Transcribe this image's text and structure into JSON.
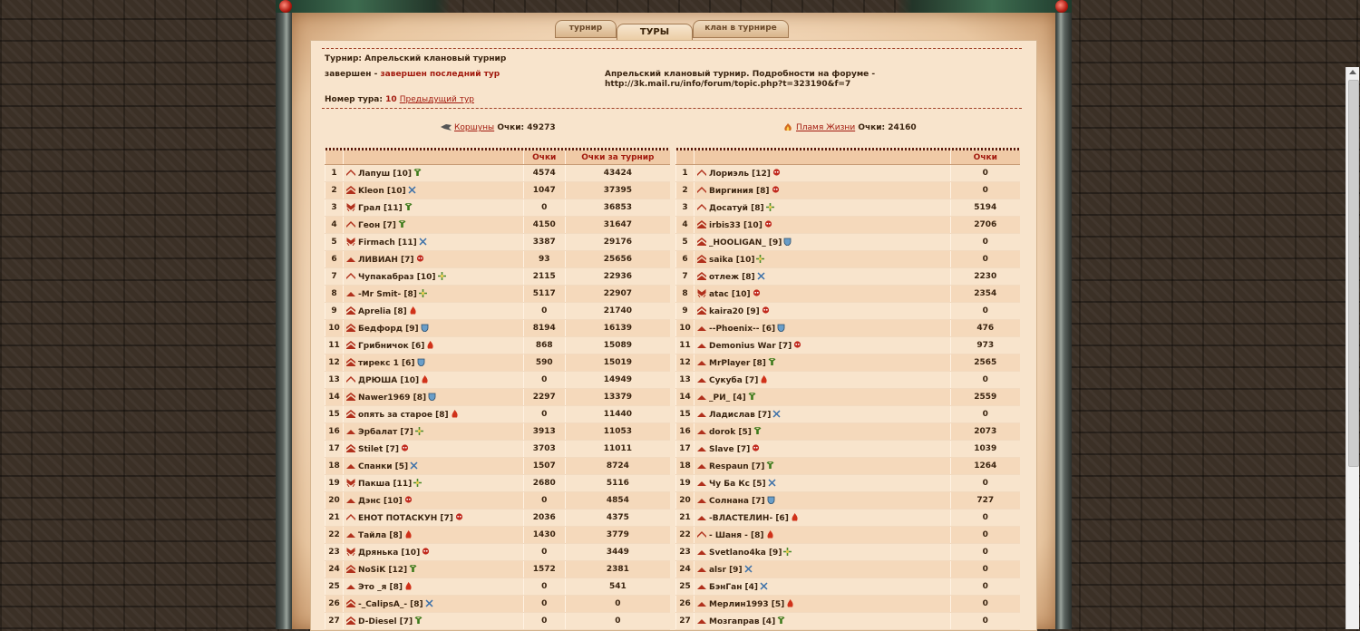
{
  "tabs": {
    "tournament": "турнир",
    "rounds": "ТУРЫ",
    "clan": "клан в турнире"
  },
  "info": {
    "tournament_label": "Турнир:",
    "tournament_name": "Апрельский клановый турнир",
    "status": "завершен",
    "status_sep": " - ",
    "status_detail": "завершен последний тур",
    "description": "Апрельский клановый турнир. Подробности на форуме -",
    "forum_link": "http://3k.mail.ru/info/forum/topic.php?t=323190&f=7",
    "round_label": "Номер тура:",
    "round_number": "10",
    "prev_round": "Предыдущий тур"
  },
  "clans": {
    "left": {
      "name": "Коршуны",
      "score_label": "Очки:",
      "score": "49273",
      "icon": "raven-flag-icon"
    },
    "right": {
      "name": "Пламя Жизни",
      "score_label": "Очки:",
      "score": "24160",
      "icon": "flame-icon"
    }
  },
  "table_left": {
    "headers": [
      "",
      "",
      "Очки",
      "Очки за турнир"
    ],
    "rows": [
      {
        "n": "1",
        "name": "Лапуш [10]",
        "badge": "elf",
        "score": "4574",
        "total": "43424",
        "rank": "r2"
      },
      {
        "n": "2",
        "name": "Kleon [10]",
        "badge": "swords",
        "score": "1047",
        "total": "37395",
        "rank": "r3"
      },
      {
        "n": "3",
        "name": "Грал [11]",
        "badge": "elf",
        "score": "0",
        "total": "36853",
        "rank": "r4"
      },
      {
        "n": "4",
        "name": "Геон [7]",
        "badge": "elf",
        "score": "4150",
        "total": "31647",
        "rank": "r2"
      },
      {
        "n": "5",
        "name": "Firmach [11]",
        "badge": "swords",
        "score": "3387",
        "total": "29176",
        "rank": "r4"
      },
      {
        "n": "6",
        "name": "ЛИВИАН [7]",
        "badge": "skull",
        "score": "93",
        "total": "25656",
        "rank": "r1"
      },
      {
        "n": "7",
        "name": "Чупакабраз [10]",
        "badge": "cross",
        "score": "2115",
        "total": "22936",
        "rank": "r2"
      },
      {
        "n": "8",
        "name": "-Mr Smit- [8]",
        "badge": "cross",
        "score": "5117",
        "total": "22907",
        "rank": "r1"
      },
      {
        "n": "9",
        "name": "Aprelia [8]",
        "badge": "fire",
        "score": "0",
        "total": "21740",
        "rank": "r3"
      },
      {
        "n": "10",
        "name": "Бедфорд [9]",
        "badge": "shield",
        "score": "8194",
        "total": "16139",
        "rank": "r3"
      },
      {
        "n": "11",
        "name": "Грибничок [6]",
        "badge": "fire",
        "score": "868",
        "total": "15089",
        "rank": "r3"
      },
      {
        "n": "12",
        "name": "тирекс 1 [6]",
        "badge": "shield",
        "score": "590",
        "total": "15019",
        "rank": "r3"
      },
      {
        "n": "13",
        "name": "ДРЮША [10]",
        "badge": "fire",
        "score": "0",
        "total": "14949",
        "rank": "r2"
      },
      {
        "n": "14",
        "name": "Nawer1969 [8]",
        "badge": "shield",
        "score": "2297",
        "total": "13379",
        "rank": "r3"
      },
      {
        "n": "15",
        "name": "опять за старое [8]",
        "badge": "fire",
        "score": "0",
        "total": "11440",
        "rank": "r3"
      },
      {
        "n": "16",
        "name": "Эрбалат [7]",
        "badge": "cross",
        "score": "3913",
        "total": "11053",
        "rank": "r1"
      },
      {
        "n": "17",
        "name": "Stilet [7]",
        "badge": "skull",
        "score": "3703",
        "total": "11011",
        "rank": "r3"
      },
      {
        "n": "18",
        "name": "Спанки [5]",
        "badge": "swords",
        "score": "1507",
        "total": "8724",
        "rank": "r1"
      },
      {
        "n": "19",
        "name": "Пакша [11]",
        "badge": "cross",
        "score": "2680",
        "total": "5116",
        "rank": "r4"
      },
      {
        "n": "20",
        "name": "Дэнс [10]",
        "badge": "skull",
        "score": "0",
        "total": "4854",
        "rank": "r1"
      },
      {
        "n": "21",
        "name": "ЕНОТ ПОТАСКУН [7]",
        "badge": "skull",
        "score": "2036",
        "total": "4375",
        "rank": "r2"
      },
      {
        "n": "22",
        "name": "Тайла [8]",
        "badge": "fire",
        "score": "1430",
        "total": "3779",
        "rank": "r1"
      },
      {
        "n": "23",
        "name": "Дрянька [10]",
        "badge": "skull",
        "score": "0",
        "total": "3449",
        "rank": "r4"
      },
      {
        "n": "24",
        "name": "NoSiK [12]",
        "badge": "elf",
        "score": "1572",
        "total": "2381",
        "rank": "r3"
      },
      {
        "n": "25",
        "name": "Это _я [8]",
        "badge": "fire",
        "score": "0",
        "total": "541",
        "rank": "r1"
      },
      {
        "n": "26",
        "name": "-_CalipsA_- [8]",
        "badge": "swords",
        "score": "0",
        "total": "0",
        "rank": "r3"
      },
      {
        "n": "27",
        "name": "D-Diesel [7]",
        "badge": "elf",
        "score": "0",
        "total": "0",
        "rank": "r3"
      }
    ]
  },
  "table_right": {
    "headers": [
      "",
      "",
      "Очки"
    ],
    "rows": [
      {
        "n": "1",
        "name": "Лориэль [12]",
        "badge": "skull",
        "score": "0",
        "rank": "r2"
      },
      {
        "n": "2",
        "name": "Виргиния [8]",
        "badge": "skull",
        "score": "0",
        "rank": "r2"
      },
      {
        "n": "3",
        "name": "Досатуй [8]",
        "badge": "cross",
        "score": "5194",
        "rank": "r2"
      },
      {
        "n": "4",
        "name": "irbis33 [10]",
        "badge": "skull",
        "score": "2706",
        "rank": "r3"
      },
      {
        "n": "5",
        "name": "_HOOLIGAN_ [9]",
        "badge": "shield",
        "score": "0",
        "rank": "r3"
      },
      {
        "n": "6",
        "name": "saika [10]",
        "badge": "cross",
        "score": "0",
        "rank": "r3"
      },
      {
        "n": "7",
        "name": "отлеж [8]",
        "badge": "swords",
        "score": "2230",
        "rank": "r3"
      },
      {
        "n": "8",
        "name": "atac [10]",
        "badge": "skull",
        "score": "2354",
        "rank": "r4"
      },
      {
        "n": "9",
        "name": "kaira20 [9]",
        "badge": "skull",
        "score": "0",
        "rank": "r3"
      },
      {
        "n": "10",
        "name": "--Phoenix-- [6]",
        "badge": "shield",
        "score": "476",
        "rank": "r1"
      },
      {
        "n": "11",
        "name": "Demonius War [7]",
        "badge": "skull",
        "score": "973",
        "rank": "r1"
      },
      {
        "n": "12",
        "name": "MrPlayer [8]",
        "badge": "elf",
        "score": "2565",
        "rank": "r1"
      },
      {
        "n": "13",
        "name": "Сукуба [7]",
        "badge": "fire",
        "score": "0",
        "rank": "r1"
      },
      {
        "n": "14",
        "name": "_РИ_ [4]",
        "badge": "elf",
        "score": "2559",
        "rank": "r1"
      },
      {
        "n": "15",
        "name": "Ладислав [7]",
        "badge": "swords",
        "score": "0",
        "rank": "r1"
      },
      {
        "n": "16",
        "name": "dorok [5]",
        "badge": "elf",
        "score": "2073",
        "rank": "r1"
      },
      {
        "n": "17",
        "name": "Slave [7]",
        "badge": "skull",
        "score": "1039",
        "rank": "r1"
      },
      {
        "n": "18",
        "name": "Respaun [7]",
        "badge": "elf",
        "score": "1264",
        "rank": "r1"
      },
      {
        "n": "19",
        "name": "Чу Ба Кс [5]",
        "badge": "swords",
        "score": "0",
        "rank": "r1"
      },
      {
        "n": "20",
        "name": "Солнана [7]",
        "badge": "shield",
        "score": "727",
        "rank": "r1"
      },
      {
        "n": "21",
        "name": "-ВЛАСТЕЛИН- [6]",
        "badge": "fire",
        "score": "0",
        "rank": "r1"
      },
      {
        "n": "22",
        "name": "- Шаня - [8]",
        "badge": "fire",
        "score": "0",
        "rank": "r2"
      },
      {
        "n": "23",
        "name": "Svetlano4ka [9]",
        "badge": "cross",
        "score": "0",
        "rank": "r1"
      },
      {
        "n": "24",
        "name": "alsr [9]",
        "badge": "swords",
        "score": "0",
        "rank": "r1"
      },
      {
        "n": "25",
        "name": "БэнГан [4]",
        "badge": "swords",
        "score": "0",
        "rank": "r1"
      },
      {
        "n": "26",
        "name": "Мерлин1993 [5]",
        "badge": "fire",
        "score": "0",
        "rank": "r1"
      },
      {
        "n": "27",
        "name": "Мозгаправ [4]",
        "badge": "elf",
        "score": "0",
        "rank": "r1"
      }
    ]
  },
  "colors": {
    "accent_red": "#a21a0e",
    "parchment": "#f8e4cc",
    "header": "#f0caa6",
    "row_alt": "#f5d9bb"
  }
}
